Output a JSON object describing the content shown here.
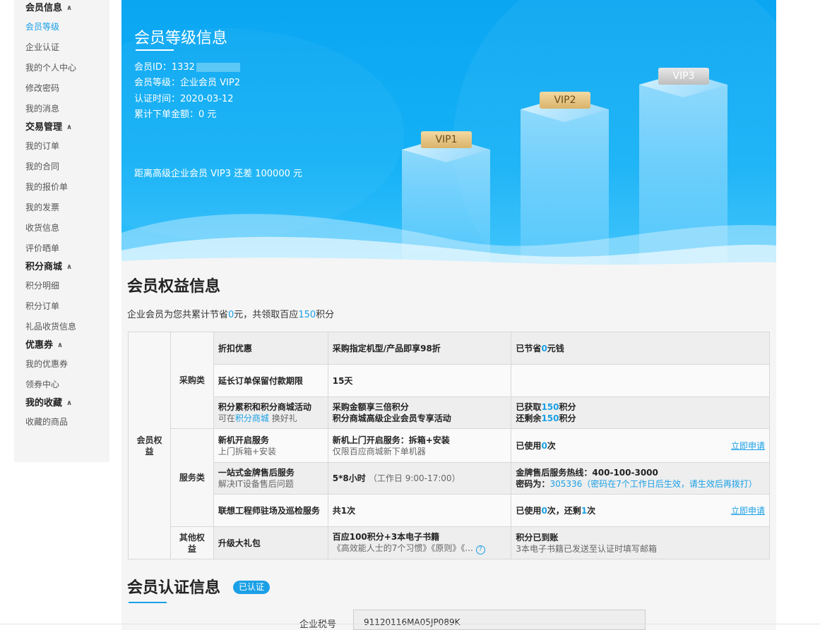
{
  "sidebar": {
    "groups": [
      {
        "label": "会员信息",
        "items": [
          "会员等级",
          "企业认证",
          "我的个人中心",
          "修改密码",
          "我的消息"
        ]
      },
      {
        "label": "交易管理",
        "items": [
          "我的订单",
          "我的合同",
          "我的报价单",
          "我的发票",
          "收货信息",
          "评价晒单"
        ]
      },
      {
        "label": "积分商城",
        "items": [
          "积分明细",
          "积分订单",
          "礼品收货信息"
        ]
      },
      {
        "label": "优惠券",
        "items": [
          "我的优惠券",
          "领券中心"
        ]
      },
      {
        "label": "我的收藏",
        "items": [
          "收藏的商品"
        ]
      }
    ],
    "active": "会员等级",
    "chevron": "∧"
  },
  "banner": {
    "title": "会员等级信息",
    "member_id_label": "会员ID：1332",
    "level_label": "会员等级：企业会员 VIP2",
    "cert_time": "认证时间：2020-03-12",
    "total_amount": "累计下单金额：0 元",
    "remaining": "距离高级企业会员 VIP3 还差 100000 元",
    "vip_levels": [
      "VIP1",
      "VIP2",
      "VIP3"
    ]
  },
  "benefits": {
    "title": "会员权益信息",
    "summary_prefix": "企业会员为您共累计节省",
    "summary_saved": "0",
    "summary_mid": "元，共领取百应",
    "summary_points": "150",
    "summary_suffix": "积分",
    "row_header": "会员权益",
    "categories": {
      "purchase": "采购类",
      "service": "服务类",
      "other": "其他权益"
    },
    "rows": [
      {
        "name": "折扣优惠",
        "desc": "采购指定机型/产品即享98折",
        "status_pre": "已节省",
        "status_val": "0",
        "status_post": "元钱"
      },
      {
        "name": "延长订单保留付款期限",
        "desc": "15天"
      },
      {
        "name": "积分累积和积分商城活动",
        "name_sub_pre": "可在",
        "name_sub_link": "积分商城",
        "name_sub_post": " 换好礼",
        "desc1": "采购金额享三倍积分",
        "desc2": "积分商城高级企业会员专享活动",
        "status1_pre": "已获取",
        "status1_val": "150",
        "status1_post": "积分",
        "status2_pre": "还剩余",
        "status2_val": "150",
        "status2_post": "积分"
      },
      {
        "name": "新机开启服务",
        "name_sub": "上门拆箱+安装",
        "desc1": "新机上门开启服务：拆箱+安装",
        "desc2": "仅限百应商城新下单机器",
        "status_pre": "已使用",
        "status_val": "0",
        "status_post": "次",
        "action": "立即申请"
      },
      {
        "name": "一站式金牌售后服务",
        "name_sub": "解决IT设备售后问题",
        "desc": "5*8小时",
        "desc_note": "（工作日 9:00-17:00）",
        "status1": "金牌售后服务热线：400-100-3000",
        "status2_pre": "密码为：",
        "status2_val": "305336（密码在7个工作日后生效，请生效后再拨打）"
      },
      {
        "name": "联想工程师驻场及巡检服务",
        "desc": "共1次",
        "status_pre": "已使用",
        "status_val": "0",
        "status_mid": "次，还剩",
        "status_val2": "1",
        "status_post": "次",
        "action": "立即申请"
      },
      {
        "name": "升级大礼包",
        "desc1": "百应100积分+3本电子书籍",
        "desc2": "《高效能人士的7个习惯》《原则》《...",
        "status1": "积分已到账",
        "status2": "3本电子书籍已发送至认证时填写邮箱",
        "help": "?"
      }
    ]
  },
  "certification": {
    "title": "会员认证信息",
    "badge": "已认证",
    "tax_label": "企业税号",
    "tax_value": "91120116MA05JP089K"
  },
  "colors": {
    "accent": "#1aa0e6",
    "banner": "#12aef5"
  }
}
